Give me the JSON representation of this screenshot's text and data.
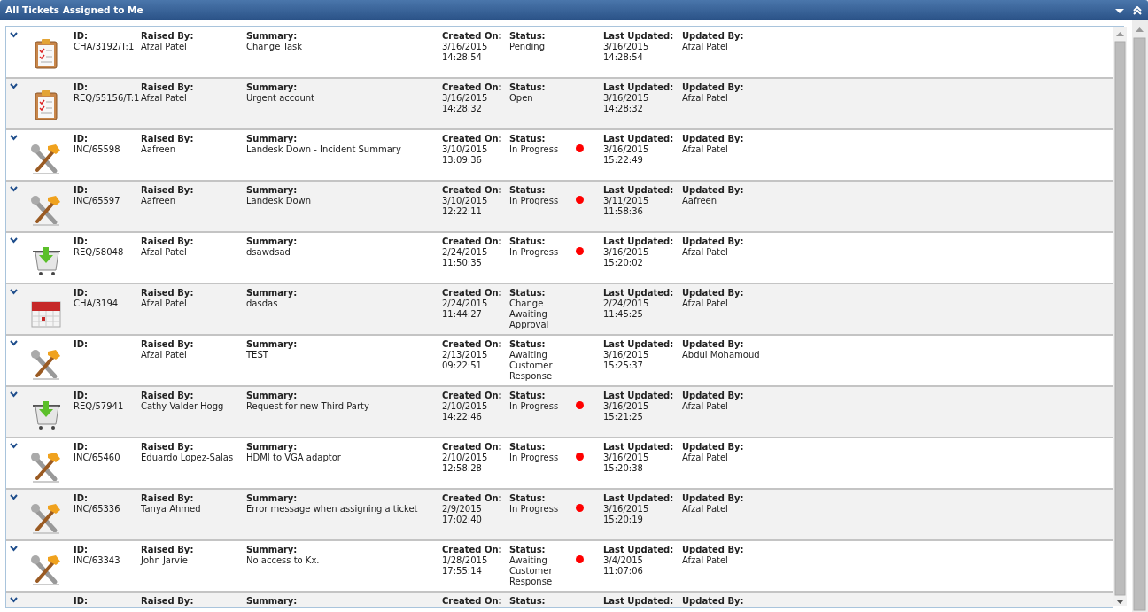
{
  "panel": {
    "title": "All Tickets Assigned to Me"
  },
  "rows": [
    {
      "kind": "task",
      "dot": false,
      "id": {
        "label": "ID:",
        "value": "CHA/3192/T:1"
      },
      "raised_by": {
        "label": "Raised By:",
        "value": "Afzal Patel"
      },
      "summary": {
        "label": "Summary:",
        "value": "Change Task"
      },
      "created_on": {
        "label": "Created On:",
        "value": "3/16/2015",
        "time": "14:28:54"
      },
      "status": {
        "label": "Status:",
        "value": "Pending"
      },
      "last_updated": {
        "label": "Last Updated:",
        "value": "3/16/2015",
        "time": "14:28:54"
      },
      "updated_by": {
        "label": "Updated By:",
        "value": "Afzal Patel"
      }
    },
    {
      "kind": "task",
      "dot": false,
      "id": {
        "label": "ID:",
        "value": "REQ/55156/T:1"
      },
      "raised_by": {
        "label": "Raised By:",
        "value": "Afzal Patel"
      },
      "summary": {
        "label": "Summary:",
        "value": "Urgent account"
      },
      "created_on": {
        "label": "Created On:",
        "value": "3/16/2015",
        "time": "14:28:32"
      },
      "status": {
        "label": "Status:",
        "value": "Open"
      },
      "last_updated": {
        "label": "Last Updated:",
        "value": "3/16/2015",
        "time": "14:28:32"
      },
      "updated_by": {
        "label": "Updated By:",
        "value": "Afzal Patel"
      }
    },
    {
      "kind": "incident",
      "dot": true,
      "id": {
        "label": "ID:",
        "value": "INC/65598"
      },
      "raised_by": {
        "label": "Raised By:",
        "value": "Aafreen"
      },
      "summary": {
        "label": "Summary:",
        "value": "Landesk Down - Incident Summary"
      },
      "created_on": {
        "label": "Created On:",
        "value": "3/10/2015",
        "time": "13:09:36"
      },
      "status": {
        "label": "Status:",
        "value": "In Progress"
      },
      "last_updated": {
        "label": "Last Updated:",
        "value": "3/16/2015",
        "time": "15:22:49"
      },
      "updated_by": {
        "label": "Updated By:",
        "value": "Afzal Patel"
      }
    },
    {
      "kind": "incident",
      "dot": true,
      "id": {
        "label": "ID:",
        "value": "INC/65597"
      },
      "raised_by": {
        "label": "Raised By:",
        "value": "Aafreen"
      },
      "summary": {
        "label": "Summary:",
        "value": "Landesk Down"
      },
      "created_on": {
        "label": "Created On:",
        "value": "3/10/2015",
        "time": "12:22:11"
      },
      "status": {
        "label": "Status:",
        "value": "In Progress"
      },
      "last_updated": {
        "label": "Last Updated:",
        "value": "3/11/2015",
        "time": "11:58:36"
      },
      "updated_by": {
        "label": "Updated By:",
        "value": "Aafreen"
      }
    },
    {
      "kind": "request",
      "dot": true,
      "id": {
        "label": "ID:",
        "value": "REQ/58048"
      },
      "raised_by": {
        "label": "Raised By:",
        "value": "Afzal Patel"
      },
      "summary": {
        "label": "Summary:",
        "value": "dsawdsad"
      },
      "created_on": {
        "label": "Created On:",
        "value": "2/24/2015",
        "time": "11:50:35"
      },
      "status": {
        "label": "Status:",
        "value": "In Progress"
      },
      "last_updated": {
        "label": "Last Updated:",
        "value": "3/16/2015",
        "time": "15:20:02"
      },
      "updated_by": {
        "label": "Updated By:",
        "value": "Afzal Patel"
      }
    },
    {
      "kind": "change",
      "dot": false,
      "id": {
        "label": "ID:",
        "value": "CHA/3194"
      },
      "raised_by": {
        "label": "Raised By:",
        "value": "Afzal Patel"
      },
      "summary": {
        "label": "Summary:",
        "value": "dasdas"
      },
      "created_on": {
        "label": "Created On:",
        "value": "2/24/2015",
        "time": "11:44:27"
      },
      "status": {
        "label": "Status:",
        "value": "Change Awaiting Approval"
      },
      "last_updated": {
        "label": "Last Updated:",
        "value": "2/24/2015",
        "time": "11:45:25"
      },
      "updated_by": {
        "label": "Updated By:",
        "value": "Afzal Patel"
      }
    },
    {
      "kind": "incident",
      "dot": false,
      "id": {
        "label": "ID:"
      },
      "raised_by": {
        "label": "Raised By:",
        "value": "Afzal Patel"
      },
      "summary": {
        "label": "Summary:",
        "value": "TEST"
      },
      "created_on": {
        "label": "Created On:",
        "value": "2/13/2015",
        "time": "09:22:51"
      },
      "status": {
        "label": "Status:",
        "value": "Awaiting Customer Response"
      },
      "last_updated": {
        "label": "Last Updated:",
        "value": "3/16/2015",
        "time": "15:25:37"
      },
      "updated_by": {
        "label": "Updated By:",
        "value": "Abdul Mohamoud"
      }
    },
    {
      "kind": "request",
      "dot": true,
      "id": {
        "label": "ID:",
        "value": "REQ/57941"
      },
      "raised_by": {
        "label": "Raised By:",
        "value": "Cathy Valder-Hogg"
      },
      "summary": {
        "label": "Summary:",
        "value": "Request for new Third Party"
      },
      "created_on": {
        "label": "Created On:",
        "value": "2/10/2015",
        "time": "14:22:46"
      },
      "status": {
        "label": "Status:",
        "value": "In Progress"
      },
      "last_updated": {
        "label": "Last Updated:",
        "value": "3/16/2015",
        "time": "15:21:25"
      },
      "updated_by": {
        "label": "Updated By:",
        "value": "Afzal Patel"
      }
    },
    {
      "kind": "incident",
      "dot": true,
      "id": {
        "label": "ID:",
        "value": "INC/65460"
      },
      "raised_by": {
        "label": "Raised By:",
        "value": "Eduardo Lopez-Salas"
      },
      "summary": {
        "label": "Summary:",
        "value": "HDMI to VGA adaptor"
      },
      "created_on": {
        "label": "Created On:",
        "value": "2/10/2015",
        "time": "12:58:28"
      },
      "status": {
        "label": "Status:",
        "value": "In Progress"
      },
      "last_updated": {
        "label": "Last Updated:",
        "value": "3/16/2015",
        "time": "15:20:38"
      },
      "updated_by": {
        "label": "Updated By:",
        "value": "Afzal Patel"
      }
    },
    {
      "kind": "incident",
      "dot": true,
      "id": {
        "label": "ID:",
        "value": "INC/65336"
      },
      "raised_by": {
        "label": "Raised By:",
        "value": "Tanya Ahmed"
      },
      "summary": {
        "label": "Summary:",
        "value": "Error message when assigning a ticket"
      },
      "created_on": {
        "label": "Created On:",
        "value": "2/9/2015",
        "time": "17:02:40"
      },
      "status": {
        "label": "Status:",
        "value": "In Progress"
      },
      "last_updated": {
        "label": "Last Updated:",
        "value": "3/16/2015",
        "time": "15:20:19"
      },
      "updated_by": {
        "label": "Updated By:",
        "value": "Afzal Patel"
      }
    },
    {
      "kind": "incident",
      "dot": true,
      "id": {
        "label": "ID:",
        "value": "INC/63343"
      },
      "raised_by": {
        "label": "Raised By:",
        "value": "John Jarvie"
      },
      "summary": {
        "label": "Summary:",
        "value": "No access to Kx."
      },
      "created_on": {
        "label": "Created On:",
        "value": "1/28/2015",
        "time": "17:55:14"
      },
      "status": {
        "label": "Status:",
        "value": "Awaiting Customer Response"
      },
      "last_updated": {
        "label": "Last Updated:",
        "value": "3/4/2015",
        "time": "11:07:06"
      },
      "updated_by": {
        "label": "Updated By:",
        "value": "Afzal Patel"
      }
    },
    {
      "dot": false,
      "id": {
        "label": "ID:"
      },
      "raised_by": {
        "label": "Raised By:"
      },
      "summary": {
        "label": "Summary:"
      },
      "created_on": {
        "label": "Created On:"
      },
      "status": {
        "label": "Status:"
      },
      "last_updated": {
        "label": "Last Updated:"
      },
      "updated_by": {
        "label": "Updated By:"
      }
    }
  ]
}
